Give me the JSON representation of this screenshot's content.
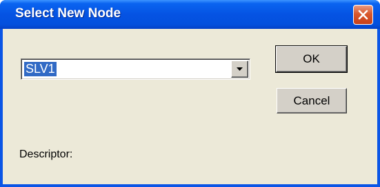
{
  "window": {
    "title": "Select New Node",
    "close_icon": "close-icon"
  },
  "combo": {
    "value": "SLV1",
    "dropdown_icon": "chevron-down-icon"
  },
  "buttons": {
    "ok_label": "OK",
    "cancel_label": "Cancel"
  },
  "descriptor_label": "Descriptor:",
  "colors": {
    "titlebar": "#0553e3",
    "client_bg": "#ece9d8",
    "selection": "#316ac5",
    "close_button": "#d9582c"
  }
}
